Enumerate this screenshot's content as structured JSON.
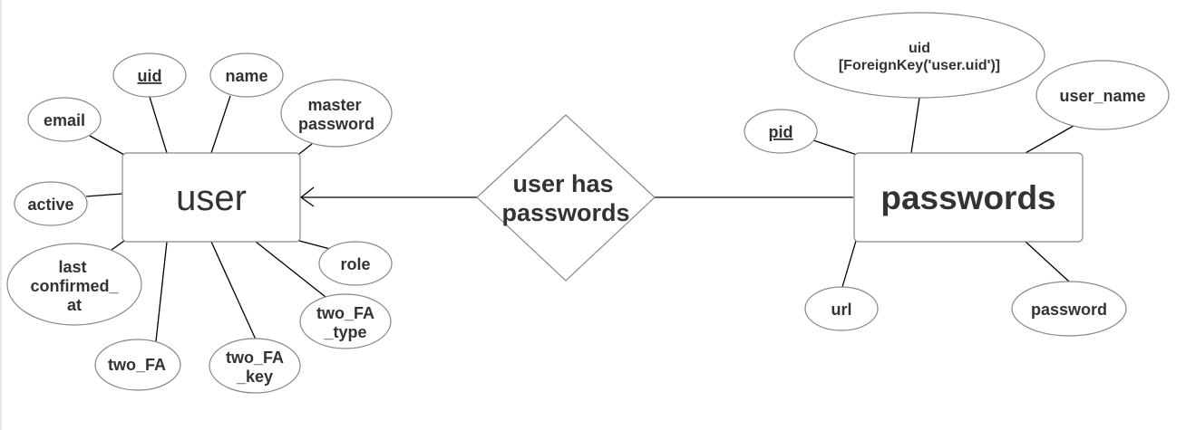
{
  "entities": {
    "user": {
      "label": "user"
    },
    "passwords": {
      "label": "passwords"
    }
  },
  "relationship": {
    "line1": "user has",
    "line2": "passwords"
  },
  "user_attributes": {
    "uid": "uid",
    "name": "name",
    "email": "email",
    "master_password": [
      "master",
      "password"
    ],
    "active": "active",
    "last_confirmed_at": [
      "last",
      "confirmed_",
      "at"
    ],
    "role": "role",
    "two_fa_type": [
      "two_FA",
      "_type"
    ],
    "two_fa": "two_FA",
    "two_fa_key": [
      "two_FA",
      "_key"
    ]
  },
  "password_attributes": {
    "uid_fk": [
      "uid",
      "[ForeignKey('user.uid')]"
    ],
    "pid": "pid",
    "user_name": "user_name",
    "url": "url",
    "password": "password"
  }
}
